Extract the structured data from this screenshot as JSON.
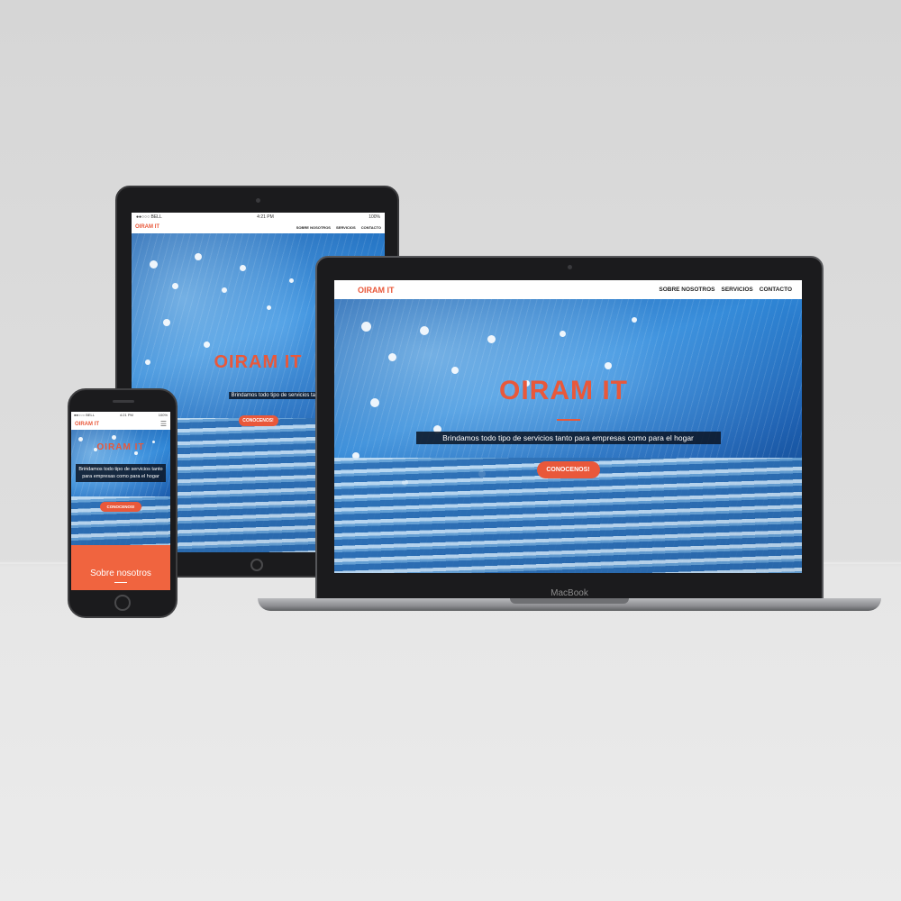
{
  "site": {
    "brand": "OIRAM IT",
    "nav": [
      "SOBRE NOSOTROS",
      "SERVICIOS",
      "CONTACTO"
    ],
    "hero_title": "OIRAM IT",
    "hero_subtitle": "Brindamos todo tipo de servicios tanto para empresas como para el hogar",
    "tablet_subtitle": "Brindamos todo tipo de servicios tanto para empresas como para el",
    "phone_subtitle": "Brindamos todo tipo de servicios tanto para empresas como para el hogar",
    "cta": "CONOCENOS!",
    "section_title": "Sobre nosotros"
  },
  "ios_status": {
    "carrier": "●●○○○ BELL",
    "time": "4:21 PM",
    "battery": "100%"
  },
  "laptop_label": "MacBook",
  "colors": {
    "accent": "#e9583a",
    "section_bg": "#f0643f",
    "frame": "#1b1b1d"
  },
  "icons": [
    "hamburger-menu-icon"
  ]
}
